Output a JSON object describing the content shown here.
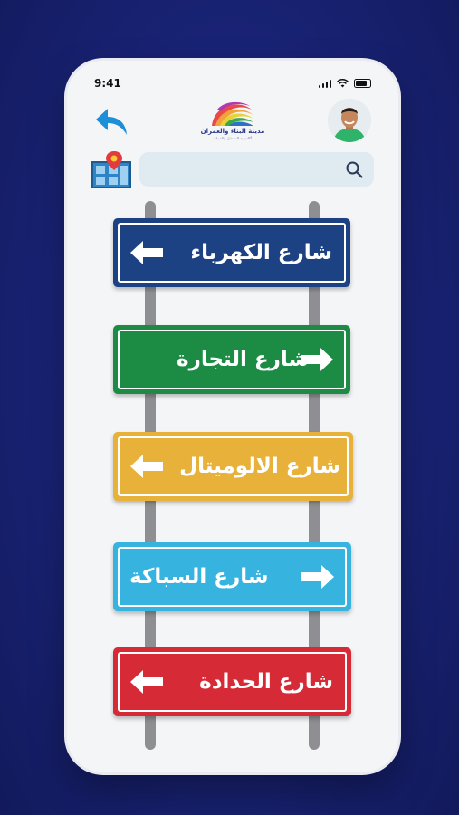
{
  "status_bar": {
    "time": "9:41"
  },
  "logo": {
    "name": "مدينة البناء والعمران",
    "tagline": "أكاديمية التشغيل والصيانة"
  },
  "search": {
    "placeholder": ""
  },
  "signs": [
    {
      "label": "شارع الكهرباء",
      "color": "#1c4283",
      "arrow": "left"
    },
    {
      "label": "شارع التجارة",
      "color": "#1c8c45",
      "arrow": "right"
    },
    {
      "label": "شارع الالوميتال",
      "color": "#e8b23a",
      "arrow": "left"
    },
    {
      "label": "شارع السباكة",
      "color": "#37b3e0",
      "arrow": "right"
    },
    {
      "label": "شارع الحدادة",
      "color": "#d62a36",
      "arrow": "left"
    }
  ],
  "colors": {
    "background": "#1a2478",
    "accent_blue": "#1c8fd8",
    "pole": "#8f8f93"
  },
  "icons": [
    "back-arrow-icon",
    "map-pin-icon",
    "search-icon",
    "signal-icon",
    "wifi-icon",
    "battery-icon"
  ]
}
